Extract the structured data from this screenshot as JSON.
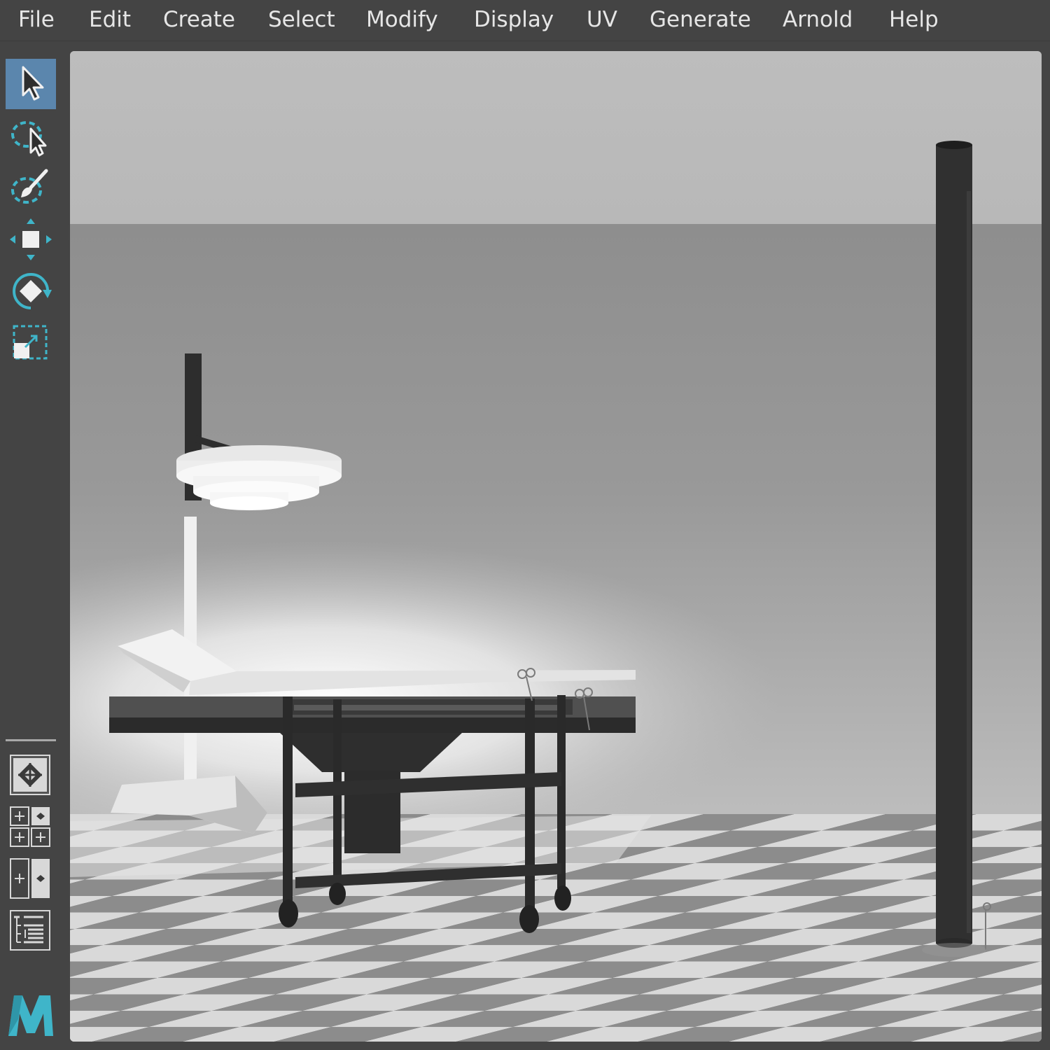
{
  "menu": {
    "items": [
      {
        "label": "File"
      },
      {
        "label": "Edit"
      },
      {
        "label": "Create"
      },
      {
        "label": "Select"
      },
      {
        "label": "Modify"
      },
      {
        "label": "Display"
      },
      {
        "label": "UV"
      },
      {
        "label": "Generate"
      },
      {
        "label": "Arnold"
      },
      {
        "label": "Help"
      }
    ]
  },
  "toolbox": {
    "tools": [
      {
        "name": "select-tool",
        "icon": "arrow-cursor-icon",
        "active": true
      },
      {
        "name": "lasso-tool",
        "icon": "lasso-select-icon",
        "active": false
      },
      {
        "name": "paint-select-tool",
        "icon": "paint-select-icon",
        "active": false
      },
      {
        "name": "move-tool",
        "icon": "move-icon",
        "active": false
      },
      {
        "name": "rotate-tool",
        "icon": "rotate-icon",
        "active": false
      },
      {
        "name": "scale-tool",
        "icon": "scale-icon",
        "active": false
      }
    ],
    "layout_buttons": [
      {
        "name": "single-perspective-view-button",
        "icon": "perspective-view-icon"
      },
      {
        "name": "four-view-layout-button",
        "icon": "four-panel-layout-icon"
      },
      {
        "name": "two-view-layout-button",
        "icon": "two-panel-layout-icon"
      },
      {
        "name": "outliner-layout-button",
        "icon": "outliner-icon"
      }
    ],
    "logo": {
      "icon": "maya-logo-icon"
    }
  },
  "colors": {
    "ui_background": "#444444",
    "menu_text": "#e6e6e6",
    "active_tool": "#5b86ad",
    "accent_teal": "#3fb5c9",
    "viewport_ceiling": "#bcbcbc",
    "viewport_wall": "#8f8f8f",
    "floor_light": "#dadada",
    "floor_dark": "#8a8a8a"
  },
  "viewport": {
    "view": "rendered perspective",
    "scene_objects": [
      "operating-lamp",
      "examination-table",
      "instrument-trolley",
      "support-column",
      "surgical-scissors"
    ]
  }
}
